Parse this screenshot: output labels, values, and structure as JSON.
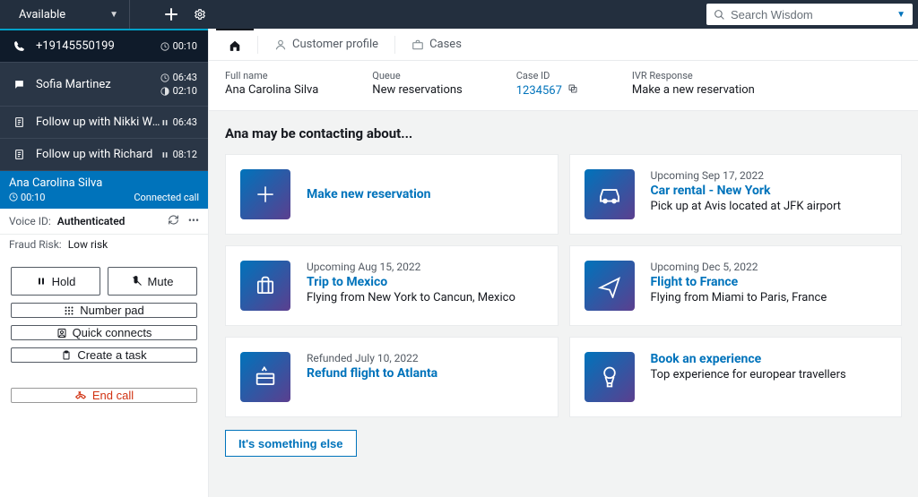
{
  "topbar": {
    "status": "Available",
    "search_placeholder": "Search Wisdom"
  },
  "contacts": [
    {
      "icon": "phone",
      "name": "+19145550199",
      "times": [
        "00:10"
      ],
      "time_icons": [
        "clock"
      ]
    },
    {
      "icon": "chat",
      "name": "Sofia Martinez",
      "times": [
        "06:43",
        "02:10"
      ],
      "time_icons": [
        "clock",
        "clock-half"
      ]
    },
    {
      "icon": "task",
      "name": "Follow up with Nikki Wolf",
      "times": [
        "06:43"
      ],
      "time_icons": [
        "pause"
      ]
    },
    {
      "icon": "task",
      "name": "Follow up with Richard",
      "times": [
        "08:12"
      ],
      "time_icons": [
        "pause"
      ]
    }
  ],
  "caller": {
    "name": "Ana Carolina Silva",
    "timer": "00:10",
    "state": "Connected call"
  },
  "voice_id": {
    "label": "Voice ID:",
    "value": "Authenticated"
  },
  "fraud": {
    "label": "Fraud Risk:",
    "value": "Low risk"
  },
  "buttons": {
    "hold": "Hold",
    "mute": "Mute",
    "numpad": "Number pad",
    "quick": "Quick connects",
    "task": "Create a task",
    "end": "End call"
  },
  "tabs": {
    "home": "",
    "profile": "Customer profile",
    "cases": "Cases"
  },
  "info": {
    "fullname_lbl": "Full name",
    "fullname": "Ana Carolina Silva",
    "queue_lbl": "Queue",
    "queue": "New reservations",
    "case_lbl": "Case ID",
    "case": "1234567",
    "ivr_lbl": "IVR Response",
    "ivr": "Make a new reservation"
  },
  "context_heading": "Ana may be contacting about...",
  "cards": [
    {
      "icon": "plus",
      "overline": "",
      "title": "Make new reservation",
      "subtitle": ""
    },
    {
      "icon": "car",
      "overline": "Upcoming Sep 17, 2022",
      "title": "Car rental - New York",
      "subtitle": "Pick up at Avis located at JFK airport"
    },
    {
      "icon": "suitcase",
      "overline": "Upcoming Aug 15, 2022",
      "title": "Trip to Mexico",
      "subtitle": "Flying from New York to Cancun, Mexico"
    },
    {
      "icon": "plane",
      "overline": "Upcoming Dec 5, 2022",
      "title": "Flight to France",
      "subtitle": "Flying from Miami to Paris, France"
    },
    {
      "icon": "refund",
      "overline": "Refunded July 10, 2022",
      "title": "Refund flight to Atlanta",
      "subtitle": ""
    },
    {
      "icon": "balloon",
      "overline": "",
      "title": "Book an experience",
      "subtitle": "Top experience for europear travellers"
    }
  ],
  "something_else": "It's something else"
}
